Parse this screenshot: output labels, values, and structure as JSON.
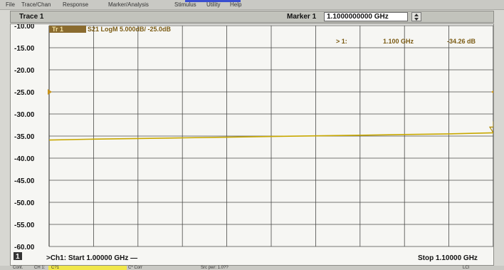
{
  "menu": [
    "File",
    "Trace/Chan",
    "Response",
    "Marker/Analysis",
    "Stimulus",
    "Utility",
    "Help"
  ],
  "title_bar": {
    "trace": "Trace 1",
    "marker_label": "Marker 1",
    "marker_value": "1.1000000000 GHz"
  },
  "trace_info": {
    "id": "Tr 1",
    "text": "S21 LogM 5.000dB/ -25.0dB"
  },
  "marker_readout": {
    "name": "> 1:",
    "freq": "1.100 GHz",
    "value": "-34.26 dB"
  },
  "bottom": {
    "channel": "1",
    "start": ">Ch1: Start  1.00000 GHz —",
    "stop": "Stop  1.10000 GHz"
  },
  "status": [
    "Cont.",
    "CH 1:",
    "C?1",
    "C* Corr",
    "Src pwr: 1.0?? ",
    "LCl"
  ],
  "colors": {
    "trace": "#c8a800",
    "trace_label_bg": "#8a6b2f",
    "reference_marker": "#c8931a",
    "status_highlight": "#f1e74a"
  },
  "chart_data": {
    "type": "line",
    "y_ticks": [
      "-10.00",
      "-15.00",
      "-20.00",
      "-25.00",
      "-30.00",
      "-35.00",
      "-40.00",
      "-45.00",
      "-50.00",
      "-55.00",
      "-60.00"
    ],
    "ylim": [
      -60,
      -10
    ],
    "xlim": [
      1.0,
      1.1
    ],
    "x_unit": "GHz",
    "y_unit": "dB",
    "reference_level": -25.0,
    "grid": true,
    "series": [
      {
        "x": [
          1.0,
          1.01,
          1.02,
          1.03,
          1.04,
          1.05,
          1.06,
          1.07,
          1.08,
          1.09,
          1.1
        ],
        "y": [
          -35.9,
          -35.7,
          -35.55,
          -35.4,
          -35.25,
          -35.1,
          -34.95,
          -34.8,
          -34.65,
          -34.5,
          -34.26
        ]
      }
    ],
    "markers": [
      {
        "x": 1.1,
        "y": -34.26
      }
    ]
  }
}
